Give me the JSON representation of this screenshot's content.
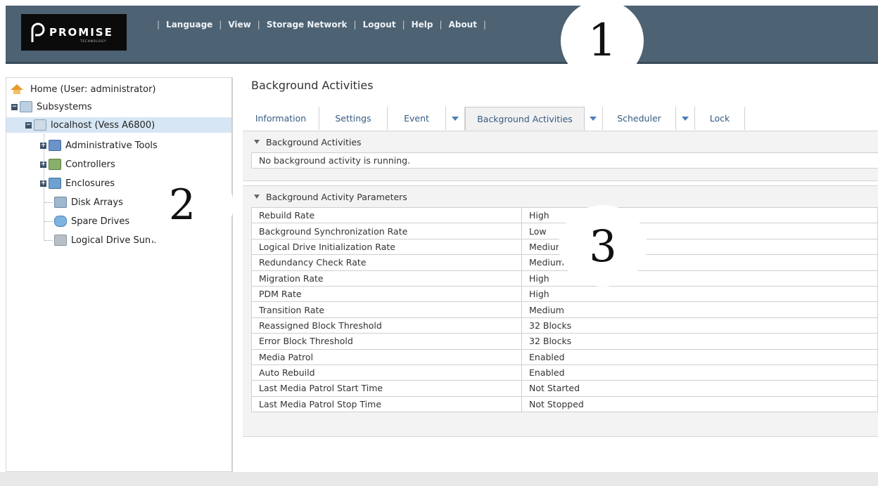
{
  "header": {
    "brand": "PROMISE",
    "brand_sub": "TECHNOLOGY",
    "nav": [
      {
        "label": "Language"
      },
      {
        "label": "View"
      },
      {
        "label": "Storage Network"
      },
      {
        "label": "Logout"
      },
      {
        "label": "Help"
      },
      {
        "label": "About"
      }
    ]
  },
  "callouts": {
    "one": "1",
    "two": "2",
    "three": "3"
  },
  "tree": {
    "home": "Home (User: administrator)",
    "subsystems": "Subsystems",
    "host": "localhost (Vess A6800)",
    "admin_tools": "Administrative Tools",
    "controllers": "Controllers",
    "enclosures": "Enclosures",
    "disk_arrays": "Disk Arrays",
    "spare_drives": "Spare Drives",
    "logical_summary": "Logical Drive Summa"
  },
  "content": {
    "title": "Background Activities",
    "tabs": {
      "information": "Information",
      "settings": "Settings",
      "event": "Event",
      "background": "Background Activities",
      "scheduler": "Scheduler",
      "lock": "Lock"
    },
    "section1": {
      "title": "Background Activities",
      "message": "No background activity is running."
    },
    "section2": {
      "title": "Background Activity Parameters",
      "rows": [
        {
          "label": "Rebuild Rate",
          "value": "High"
        },
        {
          "label": "Background Synchronization Rate",
          "value": "Low"
        },
        {
          "label": "Logical Drive Initialization Rate",
          "value": "Medium"
        },
        {
          "label": "Redundancy Check Rate",
          "value": "Medium"
        },
        {
          "label": "Migration Rate",
          "value": "High"
        },
        {
          "label": "PDM Rate",
          "value": "High"
        },
        {
          "label": "Transition Rate",
          "value": "Medium"
        },
        {
          "label": "Reassigned Block Threshold",
          "value": "32 Blocks"
        },
        {
          "label": "Error Block Threshold",
          "value": "32 Blocks"
        },
        {
          "label": "Media Patrol",
          "value": "Enabled"
        },
        {
          "label": "Auto Rebuild",
          "value": "Enabled"
        },
        {
          "label": "Last Media Patrol Start Time",
          "value": "Not Started"
        },
        {
          "label": "Last Media Patrol Stop Time",
          "value": "Not Stopped"
        }
      ]
    }
  },
  "colors": {
    "header_bg": "#4d6273",
    "link": "#355b82",
    "selected_row": "#d6e6f4"
  }
}
